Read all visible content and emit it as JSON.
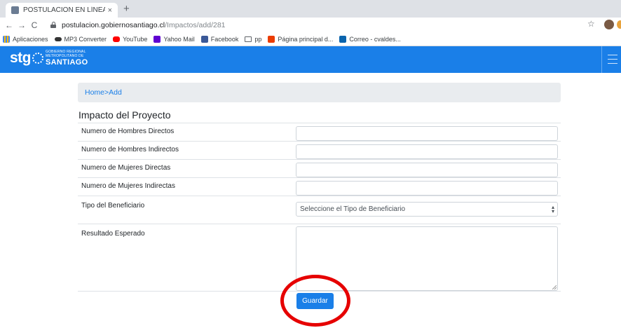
{
  "browser": {
    "tab": {
      "title": "POSTULACION EN LÍNEA",
      "close": "×"
    },
    "new_tab": "+",
    "nav": {
      "back": "←",
      "forward": "→",
      "reload": "C"
    },
    "url": {
      "host": "postulacion.gobiernosantiago.cl",
      "path": "/Impactos/add/281"
    },
    "star": "☆",
    "bookmarks": [
      {
        "label": "Aplicaciones",
        "icon": "apps-icon"
      },
      {
        "label": "MP3 Converter",
        "icon": "mp3-icon"
      },
      {
        "label": "YouTube",
        "icon": "youtube-icon"
      },
      {
        "label": "Yahoo Mail",
        "icon": "yahoo-icon"
      },
      {
        "label": "Facebook",
        "icon": "facebook-icon"
      },
      {
        "label": "pp",
        "icon": "folder-icon"
      },
      {
        "label": "Página principal d...",
        "icon": "office-icon"
      },
      {
        "label": "Correo - cvaldes...",
        "icon": "outlook-icon"
      }
    ]
  },
  "header": {
    "logo_text": "stg",
    "logo_small": "GOBIERNO REGIONAL",
    "logo_small2": "METROPOLITANO DE",
    "logo_big": "SANTIAGO",
    "accent": "#1a7fe8"
  },
  "breadcrumb": {
    "home": "Home",
    "sep": ">",
    "current": "Add"
  },
  "form": {
    "title": "Impacto del Proyecto",
    "fields": [
      {
        "label": "Numero de Hombres Directos",
        "value": ""
      },
      {
        "label": "Numero de Hombres Indirectos",
        "value": ""
      },
      {
        "label": "Numero de Mujeres Directas",
        "value": ""
      },
      {
        "label": "Numero de Mujeres Indirectas",
        "value": ""
      }
    ],
    "beneficiary": {
      "label": "Tipo del Beneficiario",
      "selected": "Seleccione el Tipo de Beneficiario"
    },
    "result": {
      "label": "Resultado Esperado",
      "value": ""
    },
    "submit_label": "Guardar"
  },
  "annotation": {
    "color": "#e60000"
  }
}
